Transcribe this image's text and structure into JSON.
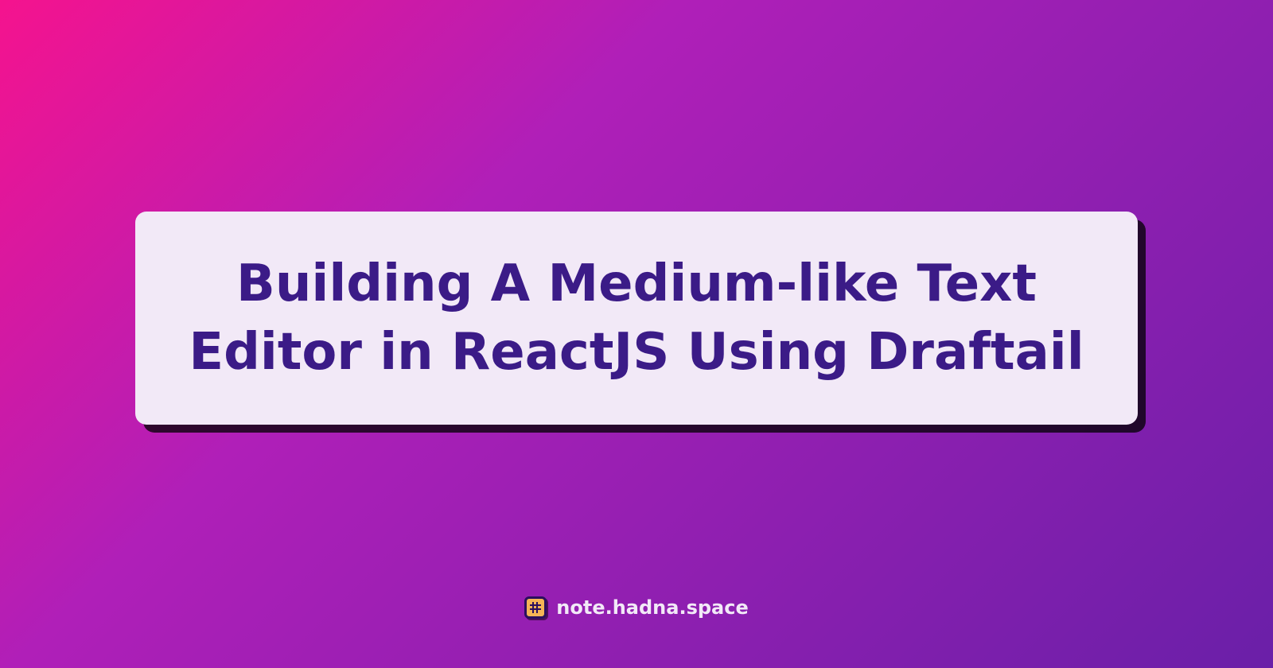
{
  "title": "Building A Medium-like Text Editor in ReactJS Using Draftail",
  "footer": {
    "site_name": "note.hadna.space",
    "icon_name": "hash-icon"
  },
  "colors": {
    "gradient_start": "#f5138e",
    "gradient_end": "#6a1fa8",
    "card_background": "#f2e9f7",
    "title_text": "#3b1b87",
    "icon_background": "#f5b456",
    "icon_border": "#2a0f5e"
  }
}
